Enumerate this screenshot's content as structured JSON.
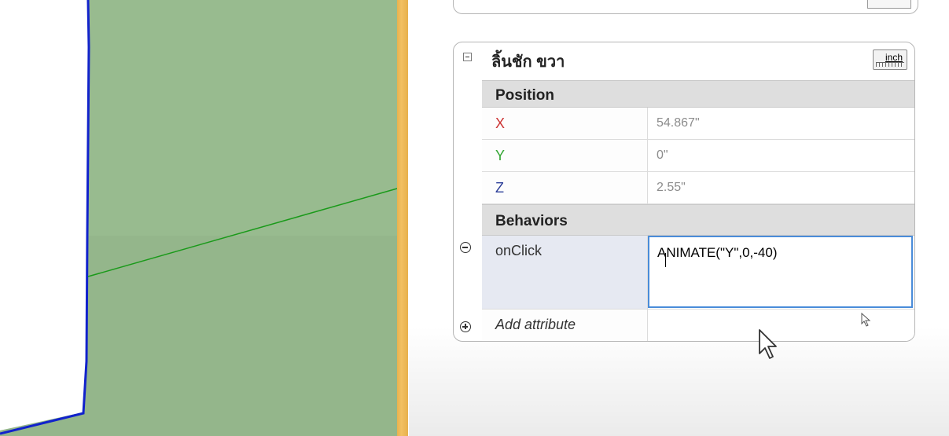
{
  "component": {
    "title": "ลิ้นชัก ขวา",
    "unit_label": "inch"
  },
  "position_section": {
    "label": "Position",
    "x": {
      "label": "X",
      "value": "54.867\"",
      "color": "#cc3333"
    },
    "y": {
      "label": "Y",
      "value": "0\"",
      "color": "#33a633"
    },
    "z": {
      "label": "Z",
      "value": "2.55\"",
      "color": "#2d3f99"
    }
  },
  "behaviors_section": {
    "label": "Behaviors",
    "onclick": {
      "label": "onClick",
      "value": "ANIMATE(\"Y\",0,-40"
    },
    "add_attribute": {
      "label": "Add attribute"
    }
  },
  "colors": {
    "viewport_green": "#98bb8f",
    "edge_blue": "#1122cc",
    "axis_green": "#1a9a1a",
    "divider": "#f0bd5c",
    "focus_blue": "#4a8cd9"
  }
}
